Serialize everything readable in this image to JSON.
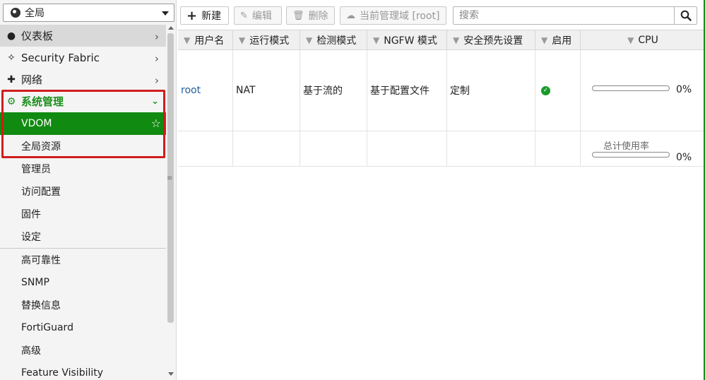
{
  "vdom_selector": {
    "value": "全局"
  },
  "menu": {
    "dashboard": "仪表板",
    "security_fabric": "Security Fabric",
    "network": "网络",
    "system": "系统管理",
    "system_items": [
      "VDOM",
      "全局资源",
      "管理员",
      "访问配置",
      "固件",
      "设定"
    ],
    "system_items2": [
      "高可靠性",
      "SNMP",
      "替换信息",
      "FortiGuard",
      "高级",
      "Feature Visibility"
    ]
  },
  "toolbar": {
    "new_label": "新建",
    "edit_label": "编辑",
    "delete_label": "删除",
    "manage_label": "当前管理域 [root]",
    "search_placeholder": "搜索"
  },
  "table": {
    "headers": [
      "用户名",
      "运行模式",
      "检测模式",
      "NGFW 模式",
      "安全预先设置",
      "启用",
      "CPU"
    ],
    "rows": [
      {
        "name": "root",
        "mode": "NAT",
        "inspection": "基于流的",
        "ngfw": "基于配置文件",
        "security": "定制",
        "enabled": true,
        "cpu_pct": "0%",
        "cpu_value": 0
      }
    ],
    "total": {
      "label": "总计使用率",
      "cpu_pct": "0%",
      "cpu_value": 0
    }
  },
  "colors": {
    "accent_green": "#118a11",
    "highlight_red": "#d11c1c",
    "link_blue": "#1f5e9a"
  }
}
